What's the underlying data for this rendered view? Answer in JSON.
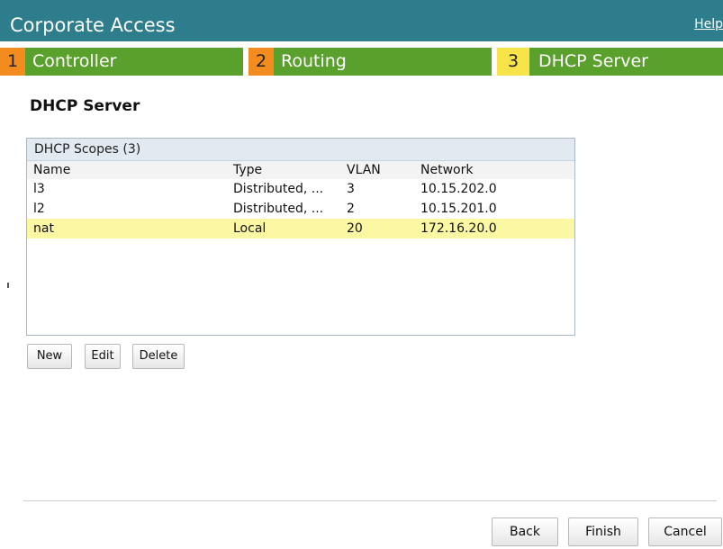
{
  "header": {
    "title": "Corporate Access",
    "help": "Help"
  },
  "steps": [
    {
      "num": "1",
      "label": "Controller"
    },
    {
      "num": "2",
      "label": "Routing"
    },
    {
      "num": "3",
      "label": "DHCP Server"
    }
  ],
  "page": {
    "title": "DHCP Server"
  },
  "scopes": {
    "header": "DHCP Scopes (3)",
    "columns": [
      "Name",
      "Type",
      "VLAN",
      "Network"
    ],
    "rows": [
      {
        "name": "l3",
        "type": "Distributed, ...",
        "vlan": "3",
        "network": "10.15.202.0"
      },
      {
        "name": "l2",
        "type": "Distributed, ...",
        "vlan": "2",
        "network": "10.15.201.0"
      },
      {
        "name": "nat",
        "type": "Local",
        "vlan": "20",
        "network": "172.16.20.0"
      }
    ]
  },
  "actions": {
    "new": "New",
    "edit": "Edit",
    "delete": "Delete"
  },
  "footer": {
    "back": "Back",
    "finish": "Finish",
    "cancel": "Cancel"
  },
  "colors": {
    "title_bar": "#2e7d8c",
    "step_green": "#5aa02c",
    "step_num_orange": "#f28c1e",
    "step_num_active": "#f7e34a",
    "selected_row": "#fbf7a2"
  }
}
